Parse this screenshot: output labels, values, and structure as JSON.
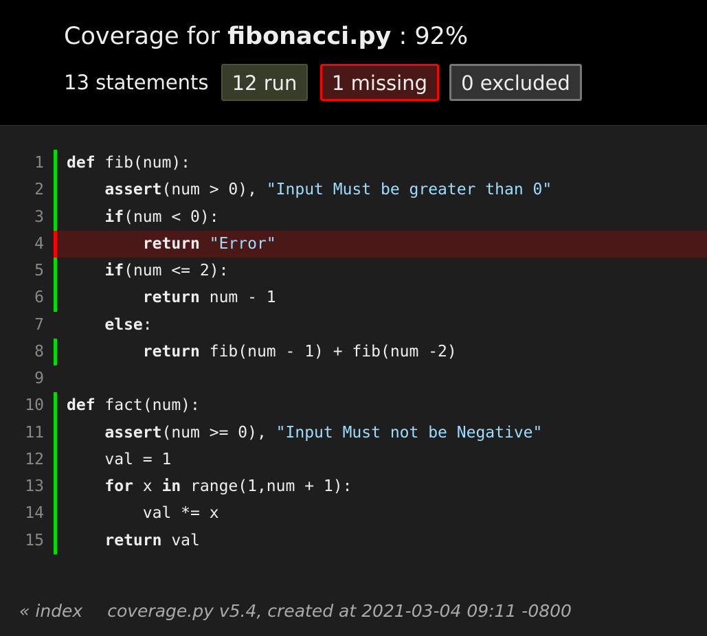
{
  "header": {
    "title_prefix": "Coverage for",
    "filename": "fibonacci.py",
    "title_suffix": ": 92%",
    "statements": "13 statements",
    "run_label": "12 run",
    "missing_label": "1 missing",
    "excluded_label": "0 excluded"
  },
  "colors": {
    "run_marker": "#00dd00",
    "missing_marker": "#ff0000",
    "missing_background": "#4b1818",
    "string": "#9cdcfe"
  },
  "source": {
    "lines": [
      {
        "n": "1",
        "status": "run",
        "tokens": [
          {
            "t": "def",
            "k": "kw"
          },
          {
            "t": " fib(num):"
          }
        ]
      },
      {
        "n": "2",
        "status": "run",
        "tokens": [
          {
            "t": "    "
          },
          {
            "t": "assert",
            "k": "kw"
          },
          {
            "t": "(num > 0), "
          },
          {
            "t": "\"Input Must be greater than 0\"",
            "k": "str"
          }
        ]
      },
      {
        "n": "3",
        "status": "run",
        "tokens": [
          {
            "t": "    "
          },
          {
            "t": "if",
            "k": "kw"
          },
          {
            "t": "(num < 0):"
          }
        ]
      },
      {
        "n": "4",
        "status": "mis",
        "tokens": [
          {
            "t": "        "
          },
          {
            "t": "return",
            "k": "kw"
          },
          {
            "t": " "
          },
          {
            "t": "\"Error\"",
            "k": "str"
          }
        ]
      },
      {
        "n": "5",
        "status": "run",
        "tokens": [
          {
            "t": "    "
          },
          {
            "t": "if",
            "k": "kw"
          },
          {
            "t": "(num <= 2):"
          }
        ]
      },
      {
        "n": "6",
        "status": "run",
        "tokens": [
          {
            "t": "        "
          },
          {
            "t": "return",
            "k": "kw"
          },
          {
            "t": " num - 1"
          }
        ]
      },
      {
        "n": "7",
        "status": "none",
        "tokens": [
          {
            "t": "    "
          },
          {
            "t": "else",
            "k": "kw"
          },
          {
            "t": ":"
          }
        ]
      },
      {
        "n": "8",
        "status": "run",
        "tokens": [
          {
            "t": "        "
          },
          {
            "t": "return",
            "k": "kw"
          },
          {
            "t": " fib(num - 1) + fib(num -2)"
          }
        ]
      },
      {
        "n": "9",
        "status": "none",
        "tokens": []
      },
      {
        "n": "10",
        "status": "run",
        "tokens": [
          {
            "t": "def",
            "k": "kw"
          },
          {
            "t": " fact(num):"
          }
        ]
      },
      {
        "n": "11",
        "status": "run",
        "tokens": [
          {
            "t": "    "
          },
          {
            "t": "assert",
            "k": "kw"
          },
          {
            "t": "(num >= 0), "
          },
          {
            "t": "\"Input Must not be Negative\"",
            "k": "str"
          }
        ]
      },
      {
        "n": "12",
        "status": "run",
        "tokens": [
          {
            "t": "    val = 1"
          }
        ]
      },
      {
        "n": "13",
        "status": "run",
        "tokens": [
          {
            "t": "    "
          },
          {
            "t": "for",
            "k": "kw"
          },
          {
            "t": " x "
          },
          {
            "t": "in",
            "k": "kw"
          },
          {
            "t": " range(1,num + 1):"
          }
        ]
      },
      {
        "n": "14",
        "status": "run",
        "tokens": [
          {
            "t": "        val *= x"
          }
        ]
      },
      {
        "n": "15",
        "status": "run",
        "tokens": [
          {
            "t": "    "
          },
          {
            "t": "return",
            "k": "kw"
          },
          {
            "t": " val"
          }
        ]
      }
    ]
  },
  "footer": {
    "index_link": "« index",
    "created": "coverage.py v5.4, created at 2021-03-04 09:11 -0800"
  }
}
